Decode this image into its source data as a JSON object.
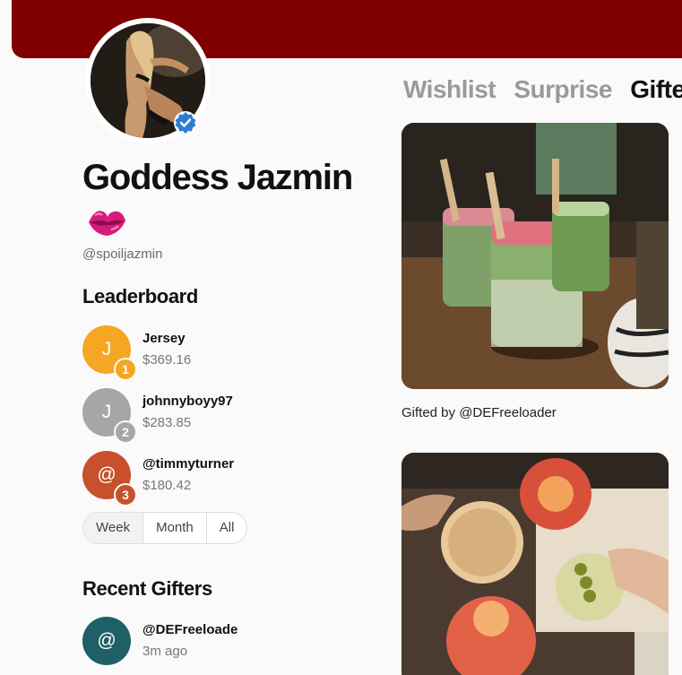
{
  "profile": {
    "name": "Goddess Jazmin",
    "emoji": "lips-kiss-emoji",
    "handle": "@spoiljazmin",
    "verified": true,
    "banner_color": "#800000"
  },
  "tabs": [
    {
      "label": "Wishlist",
      "active": false
    },
    {
      "label": "Surprise",
      "active": false
    },
    {
      "label": "Gifte",
      "active": true
    }
  ],
  "leaderboard": {
    "title": "Leaderboard",
    "entries": [
      {
        "initial": "J",
        "name": "Jersey",
        "amount": "$369.16",
        "rank": "1",
        "color": "#f5a623"
      },
      {
        "initial": "J",
        "name": "johnnyboyy97",
        "amount": "$283.85",
        "rank": "2",
        "color": "#a6a6a6"
      },
      {
        "initial": "@",
        "name": "@timmyturner",
        "amount": "$180.42",
        "rank": "3",
        "color": "#c8502c"
      }
    ],
    "periods": [
      "Week",
      "Month",
      "All"
    ]
  },
  "recent_gifters": {
    "title": "Recent Gifters",
    "entries": [
      {
        "initial": "@",
        "name": "@DEFreeloade",
        "time": "3m ago",
        "color": "#1f5f66"
      }
    ]
  },
  "gifts": [
    {
      "image": "matcha-drinks-photo",
      "caption": "Gifted by @DEFreeloader"
    },
    {
      "image": "cocktails-photo"
    }
  ]
}
